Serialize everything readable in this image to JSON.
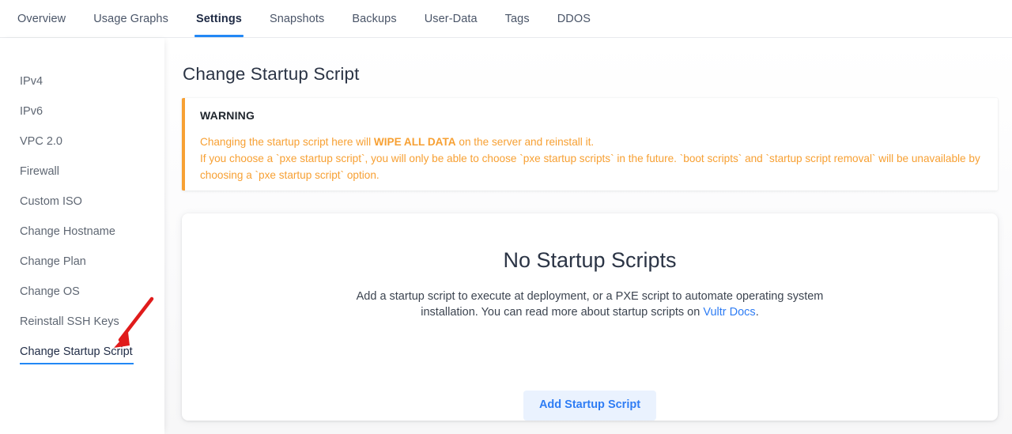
{
  "tabs": [
    {
      "label": "Overview",
      "active": false
    },
    {
      "label": "Usage Graphs",
      "active": false
    },
    {
      "label": "Settings",
      "active": true
    },
    {
      "label": "Snapshots",
      "active": false
    },
    {
      "label": "Backups",
      "active": false
    },
    {
      "label": "User-Data",
      "active": false
    },
    {
      "label": "Tags",
      "active": false
    },
    {
      "label": "DDOS",
      "active": false
    }
  ],
  "sidebar": {
    "items": [
      {
        "label": "IPv4",
        "active": false
      },
      {
        "label": "IPv6",
        "active": false
      },
      {
        "label": "VPC 2.0",
        "active": false
      },
      {
        "label": "Firewall",
        "active": false
      },
      {
        "label": "Custom ISO",
        "active": false
      },
      {
        "label": "Change Hostname",
        "active": false
      },
      {
        "label": "Change Plan",
        "active": false
      },
      {
        "label": "Change OS",
        "active": false
      },
      {
        "label": "Reinstall SSH Keys",
        "active": false
      },
      {
        "label": "Change Startup Script",
        "active": true
      }
    ]
  },
  "main": {
    "page_title": "Change Startup Script",
    "warning": {
      "heading": "WARNING",
      "line1_pre": "Changing the startup script here will ",
      "line1_bold": "WIPE ALL DATA",
      "line1_post": " on the server and reinstall it.",
      "line2": "If you choose a `pxe startup script`, you will only be able to choose `pxe startup scripts` in the future. `boot scripts` and `startup script removal` will be unavailable by choosing a `pxe startup script` option."
    },
    "empty_state": {
      "title": "No Startup Scripts",
      "description_pre": "Add a startup script to execute at deployment, or a PXE script to automate operating system installation. You can read more about startup scripts on ",
      "link_text": "Vultr Docs",
      "description_post": ".",
      "button_label": "Add Startup Script"
    }
  },
  "annotation": {
    "arrow_color": "#e01b1b"
  },
  "colors": {
    "accent_blue": "#2288f5",
    "link_blue": "#2f7df4",
    "warning_orange": "#f7a033",
    "text_dark": "#2b3445",
    "text_muted": "#5f6773",
    "button_bg": "#eaf2fe"
  }
}
